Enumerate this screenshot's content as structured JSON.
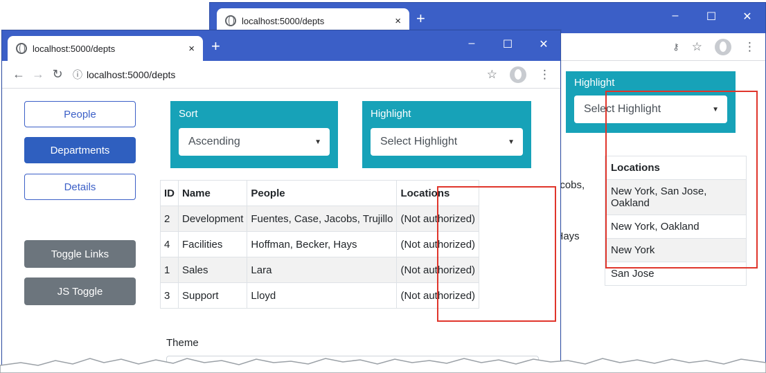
{
  "back_window": {
    "tab": {
      "title": "localhost:5000/depts",
      "close": "×",
      "new_tab": "+"
    },
    "controls": {
      "minimize": "–",
      "maximize": "☐",
      "close": "✕"
    },
    "highlight": {
      "label": "Highlight",
      "value": "Select Highlight"
    },
    "table": {
      "header": "Locations",
      "rows": [
        "New York, San Jose, Oakland",
        "New York, Oakland",
        "New York",
        "San Jose"
      ]
    },
    "partial_cells": [
      "acobs,",
      "r, Hays"
    ]
  },
  "front_window": {
    "tab": {
      "title": "localhost:5000/depts",
      "close": "×",
      "new_tab": "+"
    },
    "controls": {
      "minimize": "–",
      "maximize": "☐",
      "close": "✕"
    },
    "address": {
      "info": "ⓘ",
      "url": "localhost:5000/depts"
    },
    "nav": {
      "people": "People",
      "departments": "Departments",
      "details": "Details"
    },
    "buttons": {
      "toggle_links": "Toggle Links",
      "js_toggle": "JS Toggle"
    },
    "sort": {
      "label": "Sort",
      "value": "Ascending"
    },
    "highlight": {
      "label": "Highlight",
      "value": "Select Highlight"
    },
    "table": {
      "headers": [
        "ID",
        "Name",
        "People",
        "Locations"
      ],
      "rows": [
        [
          "2",
          "Development",
          "Fuentes, Case, Jacobs, Trujillo",
          "(Not authorized)"
        ],
        [
          "4",
          "Facilities",
          "Hoffman, Becker, Hays",
          "(Not authorized)"
        ],
        [
          "1",
          "Sales",
          "Lara",
          "(Not authorized)"
        ],
        [
          "3",
          "Support",
          "Lloyd",
          "(Not authorized)"
        ]
      ]
    },
    "theme_label": "Theme"
  },
  "colors": {
    "chrome_titlebar": "#3b5fc7",
    "panel": "#17a2b8",
    "primary": "#2f5fbf",
    "secondary": "#6c757d",
    "highlight_box": "#e0352b"
  }
}
